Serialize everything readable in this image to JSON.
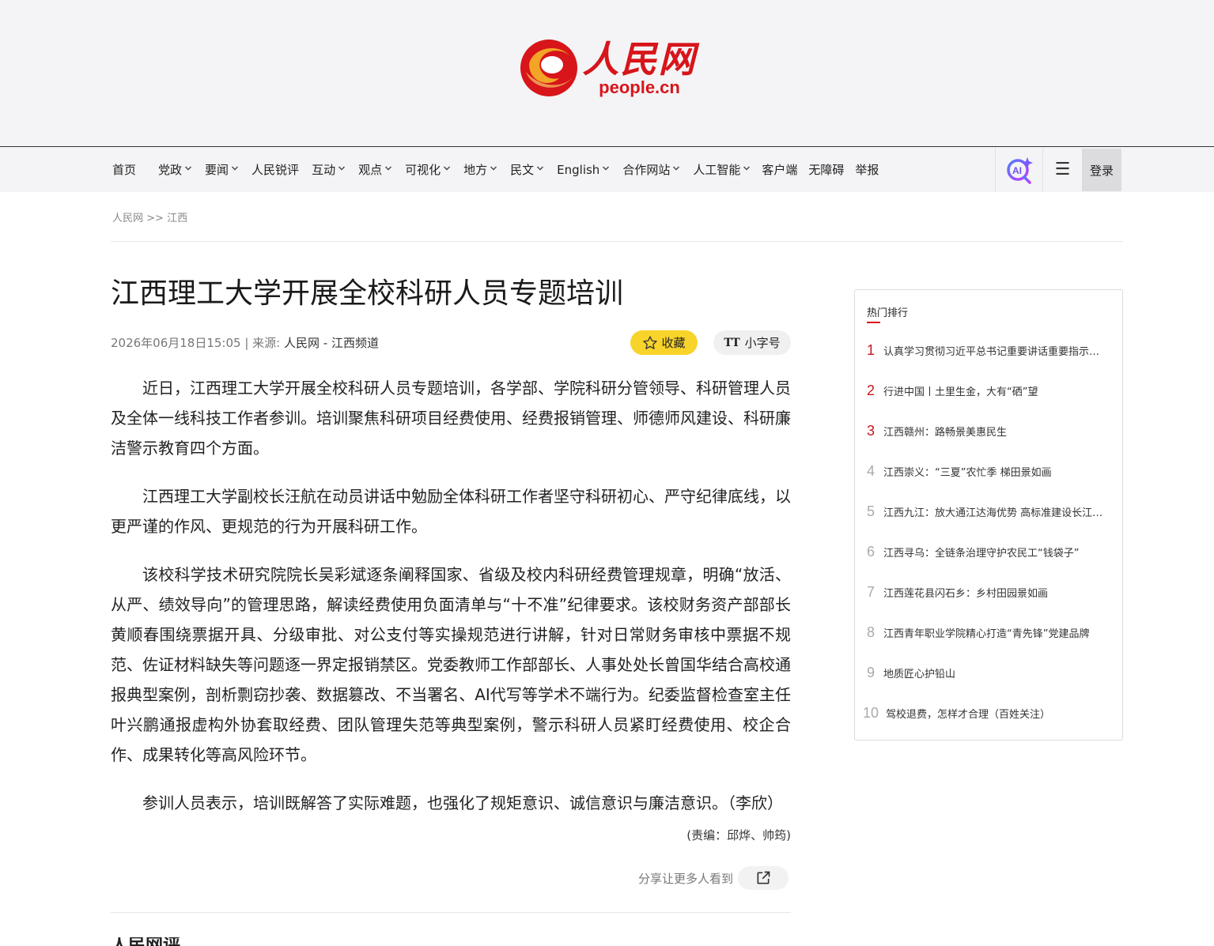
{
  "brand": {
    "cn": "人民网",
    "en": "people.cn",
    "color": "#d7151a"
  },
  "nav": {
    "items": [
      {
        "label": "首页",
        "dropdown": false
      },
      {
        "label": "党政",
        "dropdown": true
      },
      {
        "label": "要闻",
        "dropdown": true
      },
      {
        "label": "人民锐评",
        "dropdown": false
      },
      {
        "label": "互动",
        "dropdown": true
      },
      {
        "label": "观点",
        "dropdown": true
      },
      {
        "label": "可视化",
        "dropdown": true
      },
      {
        "label": "地方",
        "dropdown": true
      },
      {
        "label": "民文",
        "dropdown": true
      },
      {
        "label": "English",
        "dropdown": true
      },
      {
        "label": "合作网站",
        "dropdown": true
      },
      {
        "label": "人工智能",
        "dropdown": true
      },
      {
        "label": "客户端",
        "dropdown": false
      },
      {
        "label": "无障碍",
        "dropdown": false
      },
      {
        "label": "举报",
        "dropdown": false
      }
    ],
    "ai_icon": "ai-search-icon",
    "menu_icon": "hamburger-icon",
    "login": "登录"
  },
  "breadcrumb": {
    "home": "人民网",
    "sep": ">>",
    "section": "江西"
  },
  "article": {
    "title": "江西理工大学开展全校科研人员专题培训",
    "datetime": "2026年06月18日15:05",
    "source_prefix": "| 来源:",
    "source": "人民网 - 江西频道",
    "favorite": "收藏",
    "font_size": "小字号",
    "font_size_icon": "TT",
    "paragraphs": [
      "近日，江西理工大学开展全校科研人员专题培训，各学部、学院科研分管领导、科研管理人员及全体一线科技工作者参训。培训聚焦科研项目经费使用、经费报销管理、师德师风建设、科研廉洁警示教育四个方面。",
      "江西理工大学副校长汪航在动员讲话中勉励全体科研工作者坚守科研初心、严守纪律底线，以更严谨的作风、更规范的行为开展科研工作。",
      "该校科学技术研究院院长吴彩斌逐条阐释国家、省级及校内科研经费管理规章，明确“放活、从严、绩效导向”的管理思路，解读经费使用负面清单与“十不准”纪律要求。该校财务资产部部长黄顺春围绕票据开具、分级审批、对公支付等实操规范进行讲解，针对日常财务审核中票据不规范、佐证材料缺失等问题逐一界定报销禁区。党委教师工作部部长、人事处处长曾国华结合高校通报典型案例，剖析剽窃抄袭、数据篡改、不当署名、AI代写等学术不端行为。纪委监督检查室主任叶兴鹏通报虚构外协套取经费、团队管理失范等典型案例，警示科研人员紧盯经费使用、校企合作、成果转化等高风险环节。",
      "参训人员表示，培训既解答了实际难题，也强化了规矩意识、诚信意识与廉洁意识。（李欣）"
    ],
    "editor": "(责编：邱烨、帅筠)",
    "share": "分享让更多人看到"
  },
  "hot": {
    "title": "热门排行",
    "items": [
      {
        "rank": "1",
        "text": "认真学习贯彻习近平总书记重要讲话重要指示精神"
      },
      {
        "rank": "2",
        "text": "行进中国丨土里生金，大有“硒”望"
      },
      {
        "rank": "3",
        "text": "江西赣州：路畅景美惠民生"
      },
      {
        "rank": "4",
        "text": "江西崇义：“三夏”农忙季 梯田景如画"
      },
      {
        "rank": "5",
        "text": "江西九江：放大通江达海优势 高标准建设长江经济带"
      },
      {
        "rank": "6",
        "text": "江西寻乌：全链条治理守护农民工“钱袋子”"
      },
      {
        "rank": "7",
        "text": "江西莲花县闪石乡：乡村田园景如画"
      },
      {
        "rank": "8",
        "text": "江西青年职业学院精心打造“青先锋”党建品牌"
      },
      {
        "rank": "9",
        "text": "地质匠心护铅山"
      },
      {
        "rank": "10",
        "text": "驾校退费，怎样才合理（百姓关注）"
      }
    ]
  },
  "more_peek": "人民网评"
}
